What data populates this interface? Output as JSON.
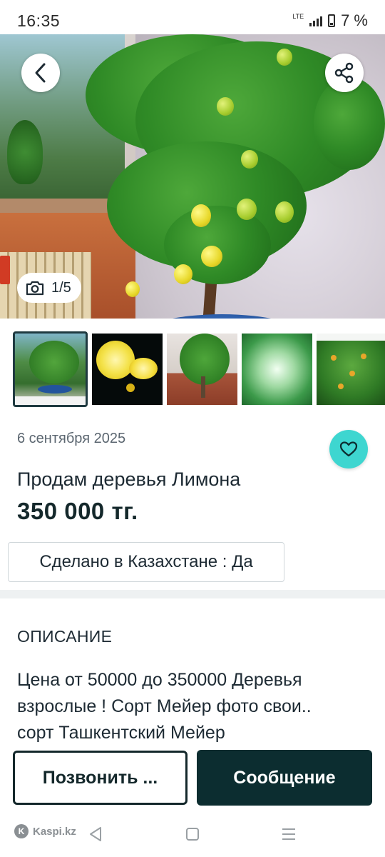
{
  "status_bar": {
    "time": "16:35",
    "network": "LTE",
    "battery": "7 %"
  },
  "gallery": {
    "counter": "1/5",
    "current_index": 1,
    "total": 5,
    "thumbnails": [
      "lemon-tree",
      "lemon-halves",
      "lemon-tree-yard",
      "aloe-plant",
      "lemon-tree-bushy"
    ]
  },
  "listing": {
    "date": "6 сентября 2025",
    "title": "Продам деревья Лимона",
    "price": "350 000 тг.",
    "attribute": "Сделано в Казахстане : Да"
  },
  "description": {
    "heading": "ОПИСАНИЕ",
    "line1": "Цена от 50000 до 350000 Деревья",
    "line2": "взрослые ! Сорт Мейер фото свои..",
    "line3": "сорт Ташкентский Мейер"
  },
  "actions": {
    "call_label": "Позвонить ...",
    "message_label": "Сообщение"
  },
  "nav": {
    "brand": "Kaspi.kz"
  },
  "colors": {
    "accent": "#3ed6d0",
    "dark": "#0c2d30",
    "text": "#1d2a33"
  }
}
